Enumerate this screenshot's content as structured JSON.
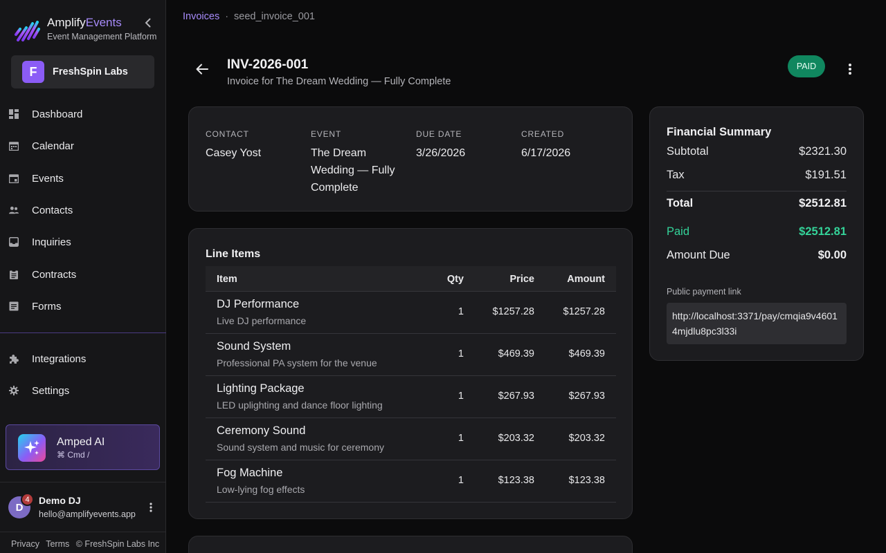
{
  "brand": {
    "name_part1": "Amplify",
    "name_part2": "Events",
    "tagline": "Event Management Platform",
    "accent_color": "#a78bfa"
  },
  "org": {
    "initial": "F",
    "name": "FreshSpin Labs"
  },
  "nav": {
    "items": [
      {
        "label": "Dashboard",
        "icon": "dashboard-icon"
      },
      {
        "label": "Calendar",
        "icon": "calendar-icon"
      },
      {
        "label": "Events",
        "icon": "event-icon"
      },
      {
        "label": "Contacts",
        "icon": "people-icon"
      },
      {
        "label": "Inquiries",
        "icon": "inbox-icon"
      },
      {
        "label": "Contracts",
        "icon": "clipboard-icon"
      },
      {
        "label": "Forms",
        "icon": "form-icon"
      }
    ],
    "secondary": [
      {
        "label": "Integrations",
        "icon": "puzzle-icon"
      },
      {
        "label": "Settings",
        "icon": "gear-icon"
      }
    ]
  },
  "ai": {
    "title": "Amped AI",
    "shortcut": "⌘ Cmd /"
  },
  "user": {
    "initial": "D",
    "badge": "4",
    "name": "Demo DJ",
    "email": "hello@amplifyevents.app"
  },
  "footer": {
    "privacy": "Privacy",
    "terms": "Terms",
    "copyright": "© FreshSpin Labs Inc"
  },
  "breadcrumb": {
    "parent": "Invoices",
    "separator": "·",
    "current": "seed_invoice_001"
  },
  "invoice": {
    "number": "INV-2026-001",
    "subtitle": "Invoice for The Dream Wedding — Fully Complete",
    "status": "PAID",
    "status_color": "#10875f"
  },
  "details": [
    {
      "label": "CONTACT",
      "value": "Casey Yost"
    },
    {
      "label": "EVENT",
      "value": "The Dream Wedding — Fully Complete"
    },
    {
      "label": "DUE DATE",
      "value": "3/26/2026"
    },
    {
      "label": "CREATED",
      "value": "6/17/2026"
    }
  ],
  "line_items": {
    "title": "Line Items",
    "headers": {
      "item": "Item",
      "qty": "Qty",
      "price": "Price",
      "amount": "Amount"
    },
    "rows": [
      {
        "name": "DJ Performance",
        "desc": "Live DJ performance",
        "qty": "1",
        "price": "$1257.28",
        "amount": "$1257.28"
      },
      {
        "name": "Sound System",
        "desc": "Professional PA system for the venue",
        "qty": "1",
        "price": "$469.39",
        "amount": "$469.39"
      },
      {
        "name": "Lighting Package",
        "desc": "LED uplighting and dance floor lighting",
        "qty": "1",
        "price": "$267.93",
        "amount": "$267.93"
      },
      {
        "name": "Ceremony Sound",
        "desc": "Sound system and music for ceremony",
        "qty": "1",
        "price": "$203.32",
        "amount": "$203.32"
      },
      {
        "name": "Fog Machine",
        "desc": "Low-lying fog effects",
        "qty": "1",
        "price": "$123.38",
        "amount": "$123.38"
      }
    ]
  },
  "summary": {
    "title": "Financial Summary",
    "subtotal_label": "Subtotal",
    "subtotal": "$2321.30",
    "tax_label": "Tax",
    "tax": "$191.51",
    "total_label": "Total",
    "total": "$2512.81",
    "paid_label": "Paid",
    "paid": "$2512.81",
    "paid_color": "#34d399",
    "due_label": "Amount Due",
    "due": "$0.00",
    "link_label": "Public payment link",
    "link": "http://localhost:3371/pay/cmqia9v46014mjdlu8pc3l33i"
  }
}
